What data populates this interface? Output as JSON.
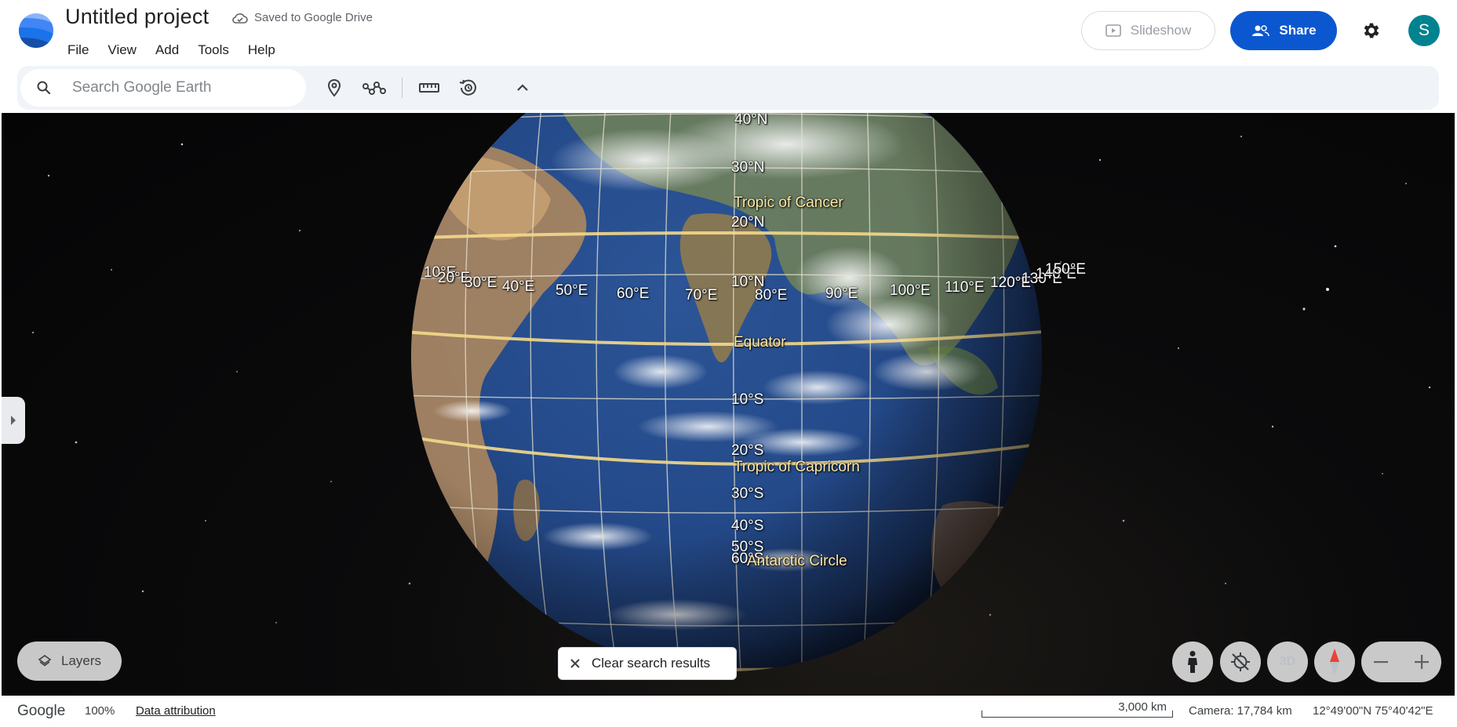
{
  "header": {
    "title": "Untitled project",
    "save_status": "Saved to Google Drive",
    "menu": [
      "File",
      "View",
      "Add",
      "Tools",
      "Help"
    ],
    "slideshow_label": "Slideshow",
    "share_label": "Share",
    "avatar_initial": "S",
    "accent_color": "#0b57d0",
    "avatar_color": "#00838f"
  },
  "toolbar": {
    "search_placeholder": "Search Google Earth",
    "icons": [
      "placemark-icon",
      "path-icon",
      "ruler-icon",
      "history-icon",
      "chevron-up-icon"
    ]
  },
  "map": {
    "latitude_labels": [
      "40°N",
      "30°N",
      "20°N",
      "10°N",
      "10°S",
      "20°S",
      "30°S",
      "40°S",
      "50°S",
      "60°S"
    ],
    "longitude_labels": [
      "10°E",
      "20°E",
      "30°E",
      "40°E",
      "50°E",
      "60°E",
      "70°E",
      "80°E",
      "90°E",
      "100°E",
      "110°E",
      "120°E",
      "130°E",
      "140°E",
      "150°E"
    ],
    "special_lines": [
      "Tropic of Cancer",
      "Equator",
      "Tropic of Capricorn",
      "Antarctic Circle"
    ],
    "layers_label": "Layers",
    "clear_search_label": "Clear search results",
    "three_d_label": "3D"
  },
  "status": {
    "brand": "Google",
    "zoom": "100%",
    "attribution": "Data attribution",
    "scale_label": "3,000 km",
    "camera": "Camera: 17,784 km",
    "coordinates": "12°49'00\"N 75°40'42\"E"
  }
}
